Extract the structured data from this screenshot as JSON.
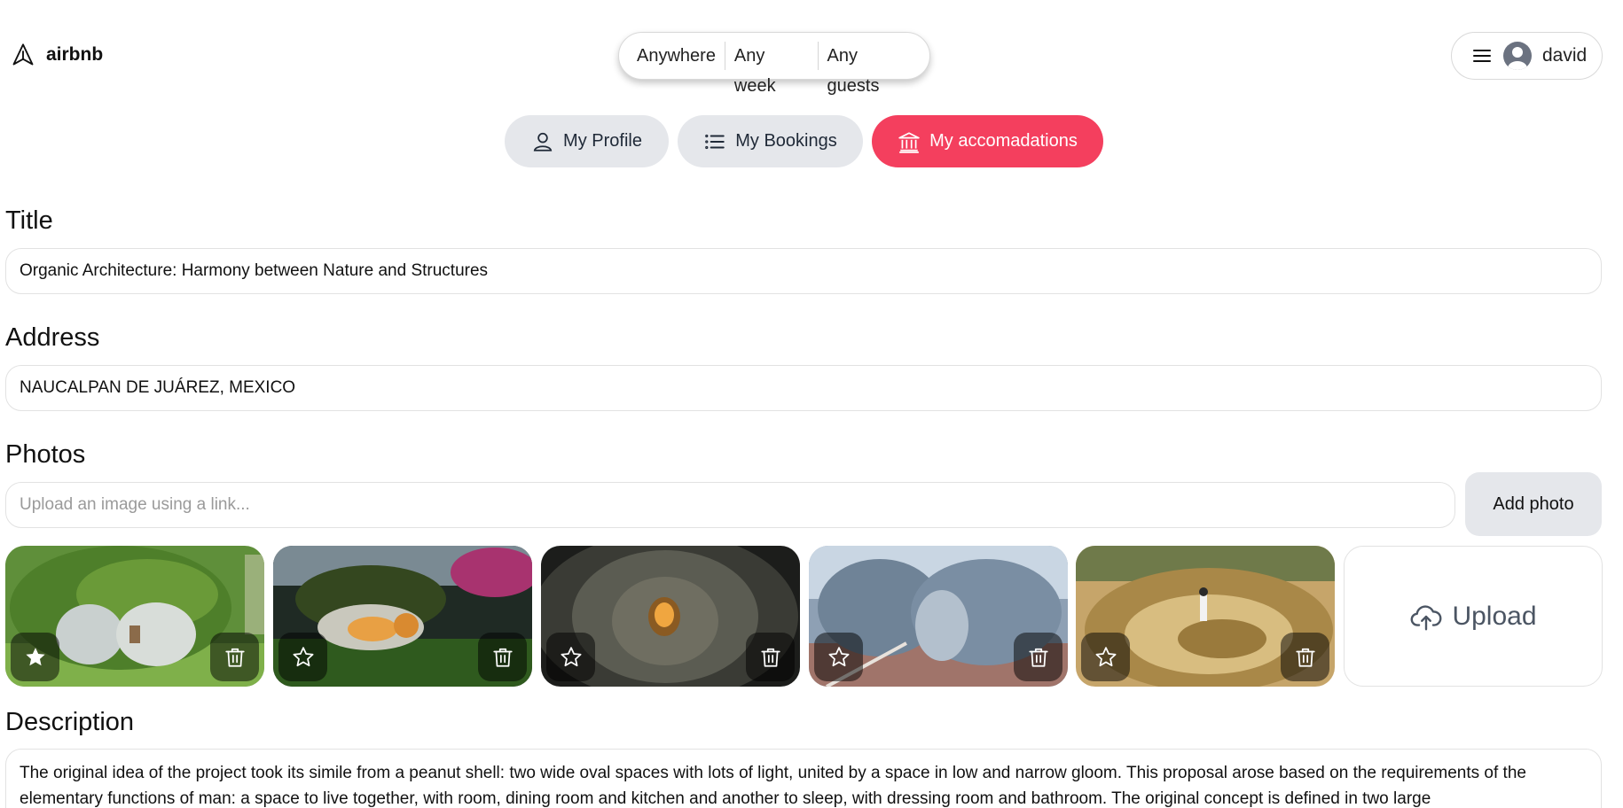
{
  "header": {
    "logo_text": "airbnb",
    "logo_icon": "paper-plane-icon",
    "search": {
      "where": "Anywhere",
      "when": "Any week",
      "who": "Any guests"
    },
    "user": {
      "menu_icon": "hamburger-icon",
      "avatar_icon": "user-avatar-icon",
      "name": "david"
    }
  },
  "tabs": [
    {
      "label": "My Profile",
      "icon": "user-icon",
      "active": false
    },
    {
      "label": "My Bookings",
      "icon": "list-icon",
      "active": false
    },
    {
      "label": "My accomadations",
      "icon": "building-columns-icon",
      "active": true
    }
  ],
  "form": {
    "title_label": "Title",
    "title_value": "Organic Architecture: Harmony between Nature and Structures",
    "address_label": "Address",
    "address_value": "NAUCALPAN DE JUÁREZ, MEXICO",
    "photos_label": "Photos",
    "photo_placeholder": "Upload an image using a link...",
    "add_photo_label": "Add photo",
    "upload_label": "Upload",
    "description_label": "Description",
    "description_value": "The original idea of the project took its simile from a peanut shell: two wide oval spaces with lots of light, united by a space in low and narrow gloom. This proposal arose based on the requirements of the elementary functions of man: a space to live together, with room, dining room and kitchen and another to sleep, with dressing room and bathroom. The original concept is defined in two large"
  },
  "photos": [
    {
      "name": "green-pod-house",
      "starred": true
    },
    {
      "name": "garden-shell-house",
      "starred": false
    },
    {
      "name": "tunnel-interior",
      "starred": false
    },
    {
      "name": "mesh-structure",
      "starred": false
    },
    {
      "name": "spiral-construction",
      "starred": false
    }
  ],
  "colors": {
    "accent": "#f43f5e",
    "tab_gray": "#e5e7eb"
  }
}
